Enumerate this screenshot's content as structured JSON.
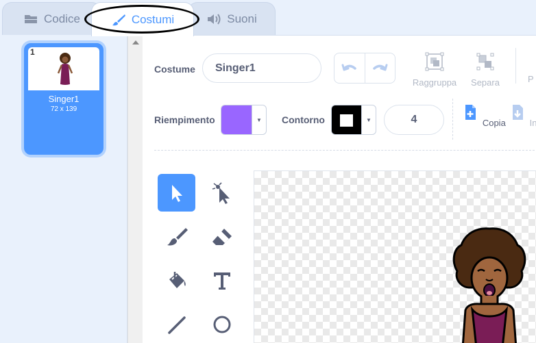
{
  "tabs": [
    {
      "label": "Codice"
    },
    {
      "label": "Costumi"
    },
    {
      "label": "Suoni"
    }
  ],
  "costumes": [
    {
      "number": "1",
      "name": "Singer1",
      "size": "72 x 139"
    }
  ],
  "editor": {
    "costume_label": "Costume",
    "costume_name": "Singer1",
    "group_label": "Raggruppa",
    "ungroup_label": "Separa",
    "forward_label_partial": "P",
    "fill_label": "Riempimento",
    "outline_label": "Contorno",
    "outline_width": "4",
    "copy_label": "Copia",
    "paste_label_partial": "Incoll"
  },
  "colors": {
    "accent": "#4c97ff",
    "fill_color": "#9966ff",
    "outline_color": "#000000",
    "text_primary": "#575e75"
  },
  "icons": [
    "code-blocks-icon",
    "paintbrush-icon",
    "speaker-icon",
    "undo-icon",
    "redo-icon",
    "group-icon",
    "ungroup-icon",
    "copy-icon",
    "paste-icon",
    "arrow-cursor-icon",
    "reshape-icon",
    "brush-icon",
    "eraser-icon",
    "paint-bucket-icon",
    "text-t-icon",
    "line-icon",
    "circle-icon"
  ]
}
